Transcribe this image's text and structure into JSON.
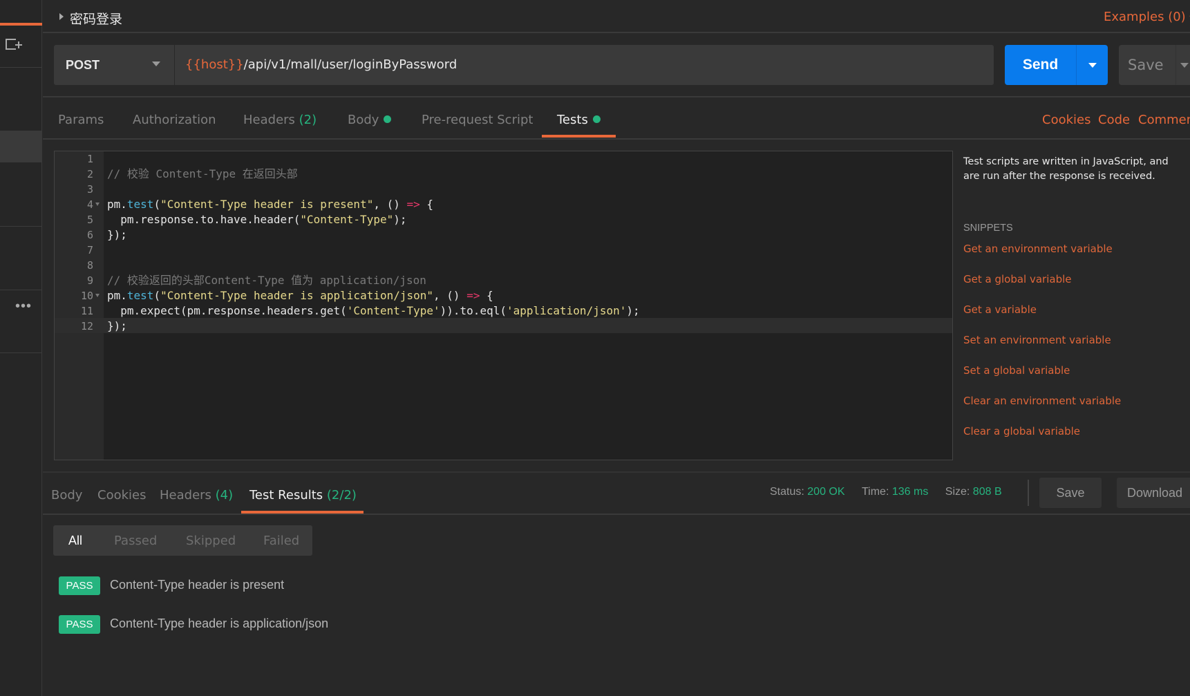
{
  "request": {
    "title": "密码登录",
    "examples": "Examples (0)",
    "method": "POST",
    "url_var": "{{host}}",
    "url_path": "/api/v1/mall/user/loginByPassword",
    "send": "Send",
    "save": "Save"
  },
  "request_tabs": [
    {
      "label": "Params"
    },
    {
      "label": "Authorization"
    },
    {
      "label": "Headers",
      "count": "(2)"
    },
    {
      "label": "Body"
    },
    {
      "label": "Pre-request Script"
    },
    {
      "label": "Tests"
    }
  ],
  "request_links": [
    "Cookies",
    "Code",
    "Comments"
  ],
  "editor": {
    "lines": [
      "",
      "// 校验 Content-Type 在返回头部",
      "",
      "pm.test(\"Content-Type header is present\", () => {",
      "  pm.response.to.have.header(\"Content-Type\");",
      "});",
      "",
      "",
      "// 校验返回的头部Content-Type 值为 application/json",
      "pm.test(\"Content-Type header is application/json\", () => {",
      "  pm.expect(pm.response.headers.get('Content-Type')).to.eql('application/json');",
      "});"
    ]
  },
  "snippets_panel": {
    "description": "Test scripts are written in JavaScript, and are run after the response is received.",
    "heading": "SNIPPETS",
    "items": [
      "Get an environment variable",
      "Get a global variable",
      "Get a variable",
      "Set an environment variable",
      "Set a global variable",
      "Clear an environment variable",
      "Clear a global variable"
    ]
  },
  "response_tabs": [
    {
      "label": "Body"
    },
    {
      "label": "Cookies"
    },
    {
      "label": "Headers",
      "count": "(4)"
    },
    {
      "label": "Test Results",
      "count": "(2/2)"
    }
  ],
  "status": {
    "status_label": "Status:",
    "status": "200 OK",
    "time_label": "Time:",
    "time": "136 ms",
    "size_label": "Size:",
    "size": "808 B",
    "save": "Save",
    "download": "Download"
  },
  "filters": [
    "All",
    "Passed",
    "Skipped",
    "Failed"
  ],
  "results": [
    {
      "badge": "PASS",
      "name": "Content-Type header is present"
    },
    {
      "badge": "PASS",
      "name": "Content-Type header is application/json"
    }
  ],
  "colors": {
    "accent": "#e8683a",
    "send": "#097bed",
    "pass": "#26b47f"
  }
}
